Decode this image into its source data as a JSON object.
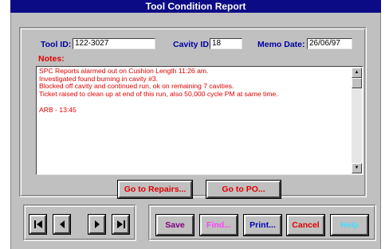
{
  "window": {
    "title": "Tool Condition Report"
  },
  "fields": {
    "tool_id": {
      "label": "Tool ID:",
      "value": "122-3027"
    },
    "cavity_id": {
      "label": "Cavity ID:",
      "value": "18"
    },
    "memo_date": {
      "label": "Memo Date:",
      "value": "26/06/97"
    }
  },
  "notes": {
    "label": "Notes:",
    "lines": [
      "SPC Reports alarmed out on Cushion Length 11:26 am.",
      "Investigated found burning in cavity #3.",
      "Blocked off cavity and continued run, ok on remaining 7 cavities.",
      "Ticket raised to clean up at end of this run, also 50,000 cycle PM at same time.",
      "",
      "ARB - 13:45"
    ]
  },
  "links": {
    "repairs": "Go to Repairs...",
    "po": "Go to PO..."
  },
  "navigation": {
    "first_icon": "first-record-icon",
    "prev_icon": "previous-record-icon",
    "next_icon": "next-record-icon",
    "last_icon": "last-record-icon"
  },
  "actions": {
    "save": {
      "label": "Save",
      "color": "#800080"
    },
    "find": {
      "label": "Find...",
      "color": "#ff40ff"
    },
    "print": {
      "label": "Print...",
      "color": "#0000c0"
    },
    "cancel": {
      "label": "Cancel",
      "color": "#e00000"
    },
    "help": {
      "label": "Help",
      "color": "#40e0ff"
    }
  },
  "colors": {
    "titlebar": "#0b0b86",
    "label_blue": "#0000a0",
    "notes_red": "#e00000",
    "face": "#c0c0c0"
  }
}
